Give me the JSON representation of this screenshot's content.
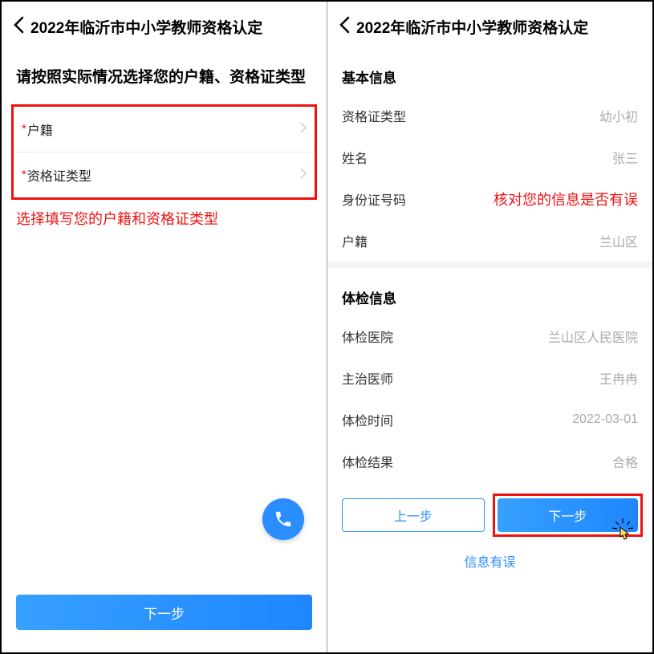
{
  "left": {
    "header_title": "2022年临沂市中小学教师资格认定",
    "instruction": "请按照实际情况选择您的户籍、资格证类型",
    "fields": {
      "household_label": "户籍",
      "cert_type_label": "资格证类型"
    },
    "annotation": "选择填写您的户籍和资格证类型",
    "next_button": "下一步"
  },
  "right": {
    "header_title": "2022年临沂市中小学教师资格认定",
    "section_basic": "基本信息",
    "basic": {
      "cert_type_label": "资格证类型",
      "cert_type_value": "幼小初",
      "name_label": "姓名",
      "name_value": "张三",
      "id_label": "身份证号码",
      "id_annotation": "核对您的信息是否有误",
      "household_label": "户籍",
      "household_value": "兰山区"
    },
    "section_exam": "体检信息",
    "exam": {
      "hospital_label": "体检医院",
      "hospital_value": "兰山区人民医院",
      "doctor_label": "主治医师",
      "doctor_value": "王冉冉",
      "date_label": "体检时间",
      "date_value": "2022-03-01",
      "result_label": "体检结果",
      "result_value": "合格"
    },
    "prev_button": "上一步",
    "next_button": "下一步",
    "error_link": "信息有误"
  }
}
